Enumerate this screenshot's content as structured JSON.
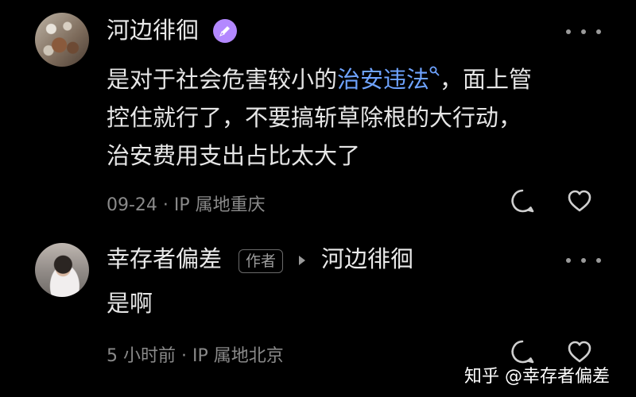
{
  "comments": [
    {
      "author": "河边徘徊",
      "content_line1_pre": "是对于社会危害较小的",
      "content_link": "治安违法",
      "content_line1_post": "，面上管",
      "content_line2": "控住就行了，不要搞斩草除根的大行动，",
      "content_line3": "治安费用支出占比太大了",
      "meta": "09-24 · IP 属地重庆"
    },
    {
      "author": "幸存者偏差",
      "author_tag": "作者",
      "reply_to": "河边徘徊",
      "content": "是啊",
      "meta": "5 小时前 · IP 属地北京"
    }
  ],
  "watermark": "知乎 @幸存者偏差",
  "colors": {
    "background": "#000000",
    "text": "#e6e6e6",
    "meta": "#8a8a8a",
    "link": "#6ea3ff",
    "badge": "#b388ff"
  },
  "icons": [
    "verified-creator-badge-icon",
    "search-link-icon",
    "more-options-icon",
    "reply-bubble-icon",
    "heart-icon",
    "reply-arrow-icon"
  ]
}
